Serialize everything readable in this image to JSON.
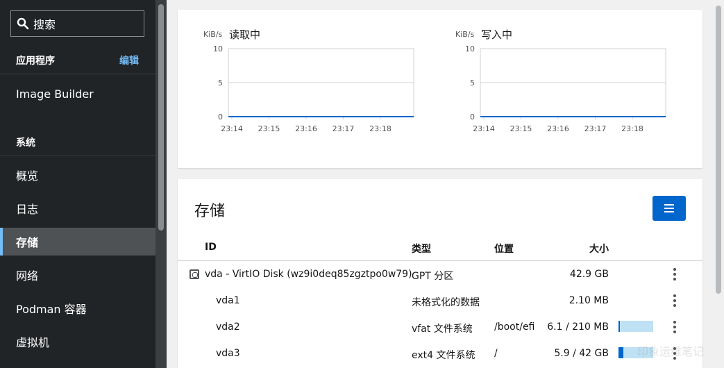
{
  "sidebar": {
    "search_placeholder": "搜索",
    "section_apps": "应用程序",
    "edit_label": "编辑",
    "app_items": [
      "Image Builder"
    ],
    "section_system": "系统",
    "items": [
      "概览",
      "日志",
      "存储",
      "网络",
      "Podman 容器",
      "虚拟机"
    ],
    "active_item": "存储"
  },
  "charts": [
    {
      "unit": "KiB/s",
      "title": "读取中"
    },
    {
      "unit": "KiB/s",
      "title": "写入中"
    }
  ],
  "chart_data": [
    {
      "type": "line",
      "title": "读取中",
      "ylabel": "KiB/s",
      "x": [
        "23:14",
        "23:15",
        "23:16",
        "23:17",
        "23:18"
      ],
      "series": [
        {
          "values": [
            0,
            0,
            0,
            0,
            0
          ]
        }
      ],
      "ylim": [
        0,
        10
      ],
      "yticks": [
        0,
        5,
        10
      ],
      "grid": true,
      "line_color": "#06c"
    },
    {
      "type": "line",
      "title": "写入中",
      "ylabel": "KiB/s",
      "x": [
        "23:14",
        "23:15",
        "23:16",
        "23:17",
        "23:18"
      ],
      "series": [
        {
          "values": [
            0,
            0,
            0,
            0,
            0
          ]
        }
      ],
      "ylim": [
        0,
        10
      ],
      "yticks": [
        0,
        5,
        10
      ],
      "grid": true,
      "line_color": "#06c"
    }
  ],
  "storage": {
    "title": "存储",
    "columns": {
      "id": "ID",
      "type": "类型",
      "location": "位置",
      "size": "大小"
    },
    "rows": [
      {
        "id": "vda - VirtIO Disk (wz9i0deq85zgztpo0w79)",
        "type": "GPT 分区",
        "location": "",
        "size": "42.9 GB",
        "usage": null,
        "is_disk": true
      },
      {
        "id": "vda1",
        "type": "未格式化的数据",
        "location": "",
        "size": "2.10 MB",
        "usage": null,
        "is_disk": false
      },
      {
        "id": "vda2",
        "type": "vfat 文件系统",
        "location": "/boot/efi",
        "size": "6.1 / 210 MB",
        "usage": 0.029,
        "is_disk": false
      },
      {
        "id": "vda3",
        "type": "ext4 文件系统",
        "location": "/",
        "size": "5.9 / 42 GB",
        "usage": 0.14,
        "is_disk": false
      }
    ]
  },
  "watermark": "印象运维笔记",
  "colors": {
    "accent": "#0066cc",
    "sidebar_bg": "#212427",
    "link": "#73bcf7",
    "usage_bg": "#bee1f4"
  }
}
